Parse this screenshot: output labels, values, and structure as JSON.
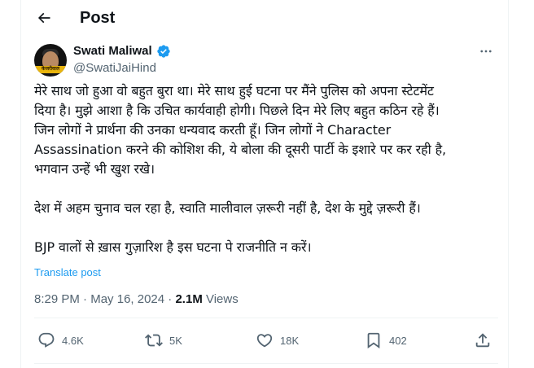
{
  "header": {
    "title": "Post",
    "back_icon": "arrow-left-icon"
  },
  "author": {
    "name": "Swati Maliwal",
    "handle": "@SwatiJaiHind",
    "avatar_band_text": "केजरीवाल",
    "verified_icon": "verified-badge-icon",
    "verified_color": "#1d9bf0"
  },
  "post": {
    "lines": [
      "मेरे साथ जो हुआ वो बहुत बुरा था। मेरे साथ हुई घटना पर मैंने पुलिस को अपना स्टेटमेंट",
      "दिया है। मुझे आशा है कि उचित कार्यवाही होगी। पिछले दिन मेरे लिए बहुत कठिन रहे हैं।",
      "जिन लोगों ने प्रार्थना की उनका धन्यवाद करती हूँ। जिन लोगों ने Character",
      "Assassination करने की कोशिश की, ये बोला की दूसरी पार्टी के इशारे पर कर रही है,",
      "भगवान उन्हें भी खुश रखे।"
    ],
    "line_para2": "देश में अहम चुनाव चल रहा है, स्वाति मालीवाल ज़रूरी नहीं है, देश के मुद्दे ज़रूरी हैं।",
    "line_para3": "BJP वालों से ख़ास गुज़ारिश है इस घटना पे राजनीति न करें।",
    "translate_label": "Translate post"
  },
  "meta": {
    "time": "8:29 PM",
    "separator": " · ",
    "date": "May 16, 2024",
    "views_count": "2.1M",
    "views_label": " Views"
  },
  "actions": {
    "replies": "4.6K",
    "reposts": "5K",
    "likes": "18K",
    "bookmarks": "402"
  },
  "colors": {
    "text": "#0f1419",
    "secondary": "#536471",
    "accent": "#1d9bf0",
    "border": "#eff3f4"
  }
}
